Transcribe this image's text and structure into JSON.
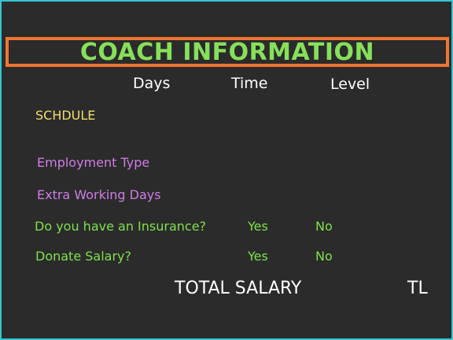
{
  "title": "COACH INFORMATION",
  "columns": {
    "days": "Days",
    "time": "Time",
    "level": "Level"
  },
  "schedule_label": "SCHDULE",
  "employment_type_label": "Employment Type",
  "extra_working_days_label": "Extra Working Days",
  "insurance": {
    "question": "Do you have an Insurance?",
    "yes": "Yes",
    "no": "No"
  },
  "donate": {
    "question": "Donate Salary?",
    "yes": "Yes",
    "no": "No"
  },
  "total_salary_label": "TOTAL SALARY",
  "currency": "TL",
  "colors": {
    "background": "#2b2b2b",
    "border": "#37c3d3",
    "title_box": "#f07532",
    "title": "#86e05a",
    "schedule": "#f1dc6e",
    "purple_labels": "#cf7de6",
    "green_labels": "#7fe04d"
  }
}
